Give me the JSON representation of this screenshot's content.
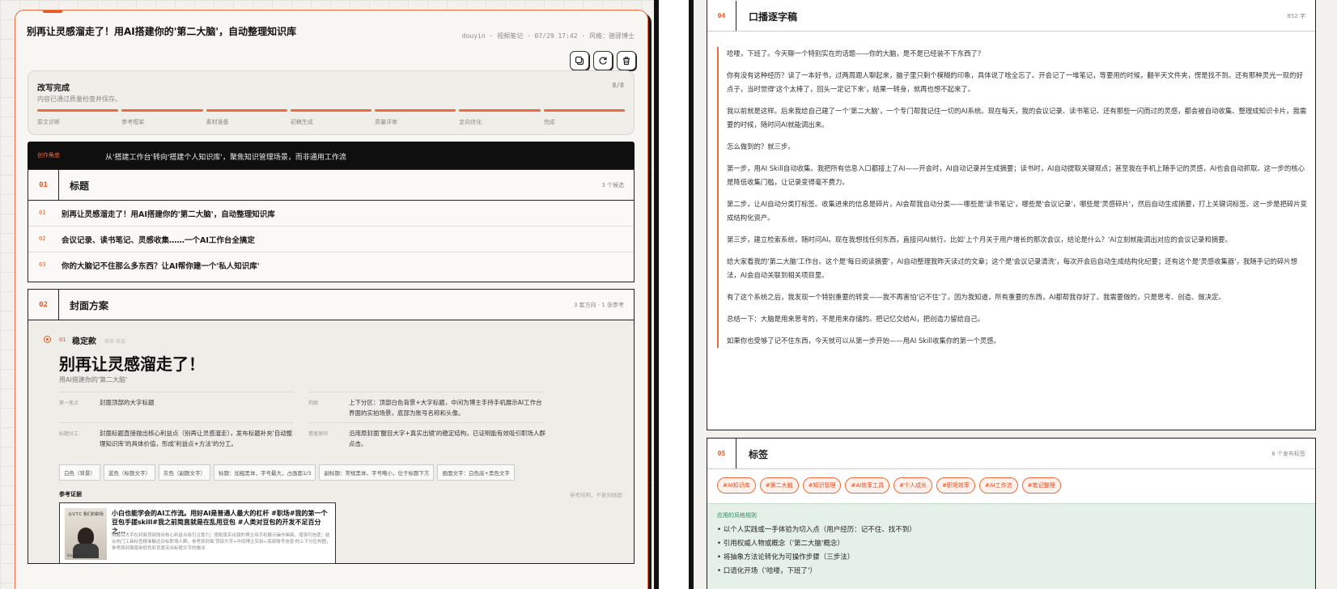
{
  "left": {
    "title": "别再让灵感溜走了！用AI搭建你的'第二大脑'，自动整理知识库",
    "meta": "douyin · 视频笔记 · 07/29 17:42 · 风格：骆驿博士",
    "icons": [
      "copy-icon",
      "refresh-icon",
      "trash-icon"
    ],
    "progress": {
      "heading": "改写完成",
      "sub": "内容已通过质量检查并保存。",
      "count": "8/8",
      "fraction": 1.0,
      "steps": [
        "原文诊断",
        "参考框架",
        "素材准备",
        "初稿生成",
        "质量评审",
        "定向优化",
        "完成"
      ]
    },
    "angle": {
      "label": "创作角度",
      "text": "从'搭建工作台'转向'搭建个人知识库'，聚焦知识管理场景，而非通用工作流"
    },
    "titles_section": {
      "num": "01",
      "title": "标题",
      "meta": "3 个候选",
      "items": [
        {
          "num": "01",
          "text": "别再让灵感溜走了！用AI搭建你的'第二大脑'，自动整理知识库"
        },
        {
          "num": "02",
          "text": "会议记录、读书笔记、灵感收集……一个AI工作台全搞定"
        },
        {
          "num": "03",
          "text": "你的大脑记不住那么多东西？让AI帮你建一个'私人知识库'"
        }
      ]
    },
    "cover_section": {
      "num": "02",
      "title": "封面方案",
      "meta": "3 套方向 · 1 张参考",
      "option_num": "01",
      "option_name": "稳定款",
      "option_tag": "推荐·首选",
      "big_title": "别再让灵感溜走了！",
      "subtitle": "用AI搭建你的'第二大脑'",
      "kv": [
        {
          "k": "第一焦点",
          "v": "封面顶部的大字标题"
        },
        {
          "k": "构图",
          "v": "上下分区：顶部白色背景+大字标题，中间为博主手持手机展示AI工作台界面的实拍场景，底部为账号名称和头像。"
        },
        {
          "k": "标题分工",
          "v": "封面标题直接抛出核心利益点（别再让灵感溜走），发布标题补充'自动整理知识库'的具体价值，形成'利益点+方法'的分工。"
        },
        {
          "k": "借鉴原则",
          "v": "沿用原封面'醒目大字+真实出镜'的稳定结构，已证明能有效吸引职场人群点击。"
        }
      ],
      "chips": [
        "白色（背景）",
        "蓝色（标题文字）",
        "灰色（副题文字）",
        "标题：加粗黑体，字号最大，占画面1/3",
        "副标题：常规黑体，字号略小，位于标题下方",
        "画面文字：白色底+黑色文字"
      ],
      "ref_heading": "参考证据",
      "ref_right": "参考结构，不复刻画面",
      "ref_title": "小白也能学会的AI工作流。用好AI是普通人最大的杠杆 #职场#我的第一个豆包手搓skill#我之前简直就是在乱用豆包 #人类对豆包的开发不足百分之...",
      "ref_desc": "用醒目大字在封面顶部抛出核心利益点吸引注意力；搭配真实出镜的博主持手机展示操作画面，增强可信度；结合热门工具标签精准触达目标职场人群。参考原封面'顶部大字+中间博主实拍+底部账号信息'的上下分区构图，参考原封面使用低色彩背景突出标题文字的做法",
      "thumb_text": "从V.T.C\n我们的职场",
      "thumb_bottom": "Sina职场博士"
    }
  },
  "right": {
    "script_section": {
      "num": "04",
      "title": "口播逐字稿",
      "meta": "852 字",
      "paragraphs": [
        "哈喽，下班了。今天聊一个特别实在的话题——你的大脑，是不是已经装不下东西了？",
        "你有没有这种经历？读了一本好书，过两周跟人聊起来，脑子里只剩个模糊的印象，具体说了啥全忘了。开会记了一堆笔记，等要用的时候，翻半天文件夹，愣是找不到。还有那种灵光一现的好点子，当时觉得'这个太棒了，回头一定记下来'，结果一转身，就再也想不起来了。",
        "我以前就是这样。后来我给自己建了一个'第二大脑'，一个专门帮我记住一切的AI系统。现在每天，我的会议记录、读书笔记、还有那些一闪而过的灵感，都会被自动收集、整理成知识卡片，我需要的时候，随时问AI就能调出来。",
        "怎么做到的？就三步。",
        "第一步，用AI Skill自动收集。我把所有信息入口都接上了AI——开会时，AI自动记录并生成摘要；读书时，AI自动提取关键观点；甚至我在手机上随手记的灵感，AI也会自动抓取。这一步的核心是降低收集门槛，让记录变得毫不费力。",
        "第二步，让AI自动分类打标签。收集进来的信息是碎片，AI会帮我自动分类——哪些是'读书笔记'，哪些是'会议记录'，哪些是'灵感碎片'，然后自动生成摘要，打上关键词标签。这一步是把碎片变成结构化资产。",
        "第三步，建立检索系统，随时问AI。现在我想找任何东西，直接问AI就行。比如'上个月关于用户增长的那次会议，结论是什么？'AI立刻就能调出对应的会议记录和摘要。",
        "给大家看我的'第二大脑'工作台。这个是'每日阅读摘要'，AI自动整理我昨天读过的文章；这个是'会议记录清洗'，每次开会后自动生成结构化纪要；还有这个是'灵感收集器'，我随手记的碎片想法，AI会自动关联到相关项目里。",
        "有了这个系统之后，我发现一个特别重要的转变——我不再害怕'记不住'了。因为我知道，所有重要的东西，AI都帮我存好了。我需要做的，只是思考、创造、做决定。",
        "总结一下：大脑是用来思考的，不是用来存储的。把记忆交给AI，把创造力留给自己。",
        "如果你也受够了记不住东西，今天就可以从第一步开始——用AI Skill收集你的第一个灵感。"
      ]
    },
    "tags_section": {
      "num": "05",
      "title": "标签",
      "meta": "8 个发布标签",
      "tags": [
        "#AI知识库",
        "#第二大脑",
        "#知识管理",
        "#AI效率工具",
        "#个人成长",
        "#职场效率",
        "#AI工作流",
        "#笔记整理"
      ],
      "style_heading": "应用的风格规则",
      "style_items": [
        "以个人实践或一手体验为切入点（用户经历：记不住、找不到）",
        "引用权威人物或概念（'第二大脑'概念）",
        "将抽象方法论转化为可操作步骤（三步法）",
        "口语化开场（'哈喽，下班了'）"
      ]
    }
  },
  "colors": {
    "accent": "#ec5a24",
    "dark": "#0f0f0f",
    "style_bg": "#e5f0e8"
  }
}
